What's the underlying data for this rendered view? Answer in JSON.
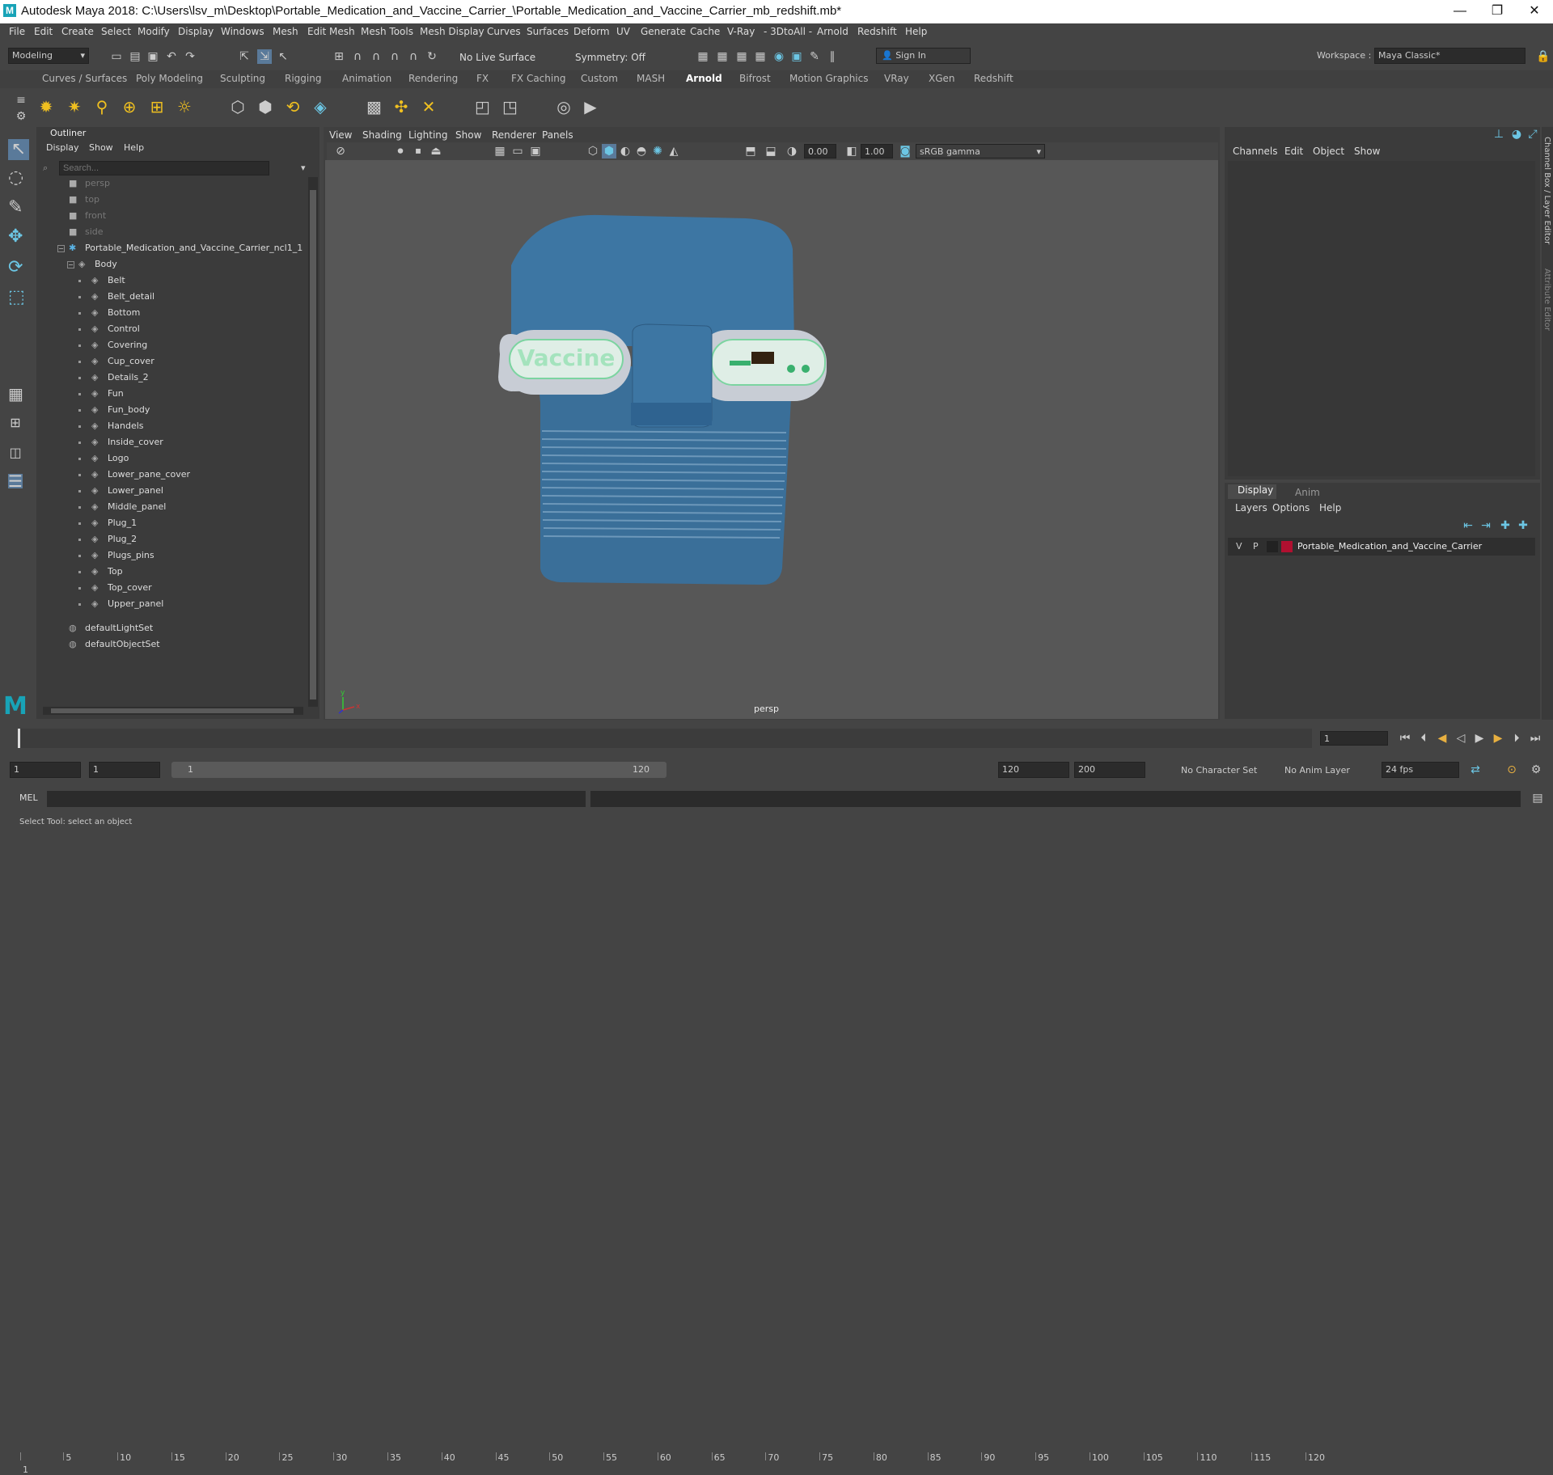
{
  "window": {
    "logo_letter": "M",
    "title": "Autodesk Maya 2018: C:\\Users\\lsv_m\\Desktop\\Portable_Medication_and_Vaccine_Carrier_\\Portable_Medication_and_Vaccine_Carrier_mb_redshift.mb*",
    "minimize": "—",
    "maximize": "❐",
    "close": "✕"
  },
  "menubar": [
    "File",
    "Edit",
    "Create",
    "Select",
    "Modify",
    "Display",
    "Windows",
    "Mesh",
    "Edit Mesh",
    "Mesh Tools",
    "Mesh Display",
    "Curves",
    "Surfaces",
    "Deform",
    "UV",
    "Generate",
    "Cache",
    "V-Ray",
    "- 3DtoAll -",
    "Arnold",
    "Redshift",
    "Help"
  ],
  "statusline": {
    "mode": "Modeling",
    "live_surface": "No Live Surface",
    "symmetry": "Symmetry: Off",
    "sign_in": "Sign In",
    "workspace_label": "Workspace :",
    "workspace_value": "Maya Classic*"
  },
  "shelf_tabs": [
    "Curves / Surfaces",
    "Poly Modeling",
    "Sculpting",
    "Rigging",
    "Animation",
    "Rendering",
    "FX",
    "FX Caching",
    "Custom",
    "MASH",
    "Arnold",
    "Bifrost",
    "Motion Graphics",
    "VRay",
    "XGen",
    "Redshift"
  ],
  "shelf_active": "Arnold",
  "outliner": {
    "title": "Outliner",
    "menu": [
      "Display",
      "Show",
      "Help"
    ],
    "search_placeholder": "Search...",
    "cameras": [
      "persp",
      "top",
      "front",
      "side"
    ],
    "root": "Portable_Medication_and_Vaccine_Carrier_ncl1_1",
    "group": "Body",
    "children": [
      "Belt",
      "Belt_detail",
      "Bottom",
      "Control",
      "Covering",
      "Cup_cover",
      "Details_2",
      "Fun",
      "Fun_body",
      "Handels",
      "Inside_cover",
      "Logo",
      "Lower_pane_cover",
      "Lower_panel",
      "Middle_panel",
      "Plug_1",
      "Plug_2",
      "Plugs_pins",
      "Top",
      "Top_cover",
      "Upper_panel"
    ],
    "sets": [
      "defaultLightSet",
      "defaultObjectSet"
    ]
  },
  "viewport": {
    "menu": [
      "View",
      "Shading",
      "Lighting",
      "Show",
      "Renderer",
      "Panels"
    ],
    "exposure": "0.00",
    "gamma": "1.00",
    "color_space": "sRGB gamma",
    "camera_label": "persp",
    "model_label_left": "Vaccine",
    "axis_y": "y",
    "axis_x": "x"
  },
  "channel_box": {
    "menu": [
      "Channels",
      "Edit",
      "Object",
      "Show"
    ],
    "side_tab_1": "Channel Box / Layer Editor",
    "side_tab_2": "Attribute Editor"
  },
  "layer_editor": {
    "tabs": [
      "Display",
      "Anim"
    ],
    "menu": [
      "Layers",
      "Options",
      "Help"
    ],
    "v": "V",
    "p": "P",
    "layer_name": "Portable_Medication_and_Vaccine_Carrier",
    "layer_color": "#b01030"
  },
  "timeline": {
    "ticks": [
      "1",
      "5",
      "10",
      "15",
      "20",
      "25",
      "30",
      "35",
      "40",
      "45",
      "50",
      "55",
      "60",
      "65",
      "70",
      "75",
      "80",
      "85",
      "90",
      "95",
      "100",
      "105",
      "110",
      "115",
      "120"
    ],
    "current_frame": "1"
  },
  "range": {
    "start": "1",
    "start2": "1",
    "slider_start": "1",
    "slider_end": "120",
    "end": "120",
    "end2": "200",
    "character_set": "No Character Set",
    "anim_layer": "No Anim Layer",
    "fps": "24 fps"
  },
  "command": {
    "lang": "MEL"
  },
  "help_line": "Select Tool: select an object"
}
